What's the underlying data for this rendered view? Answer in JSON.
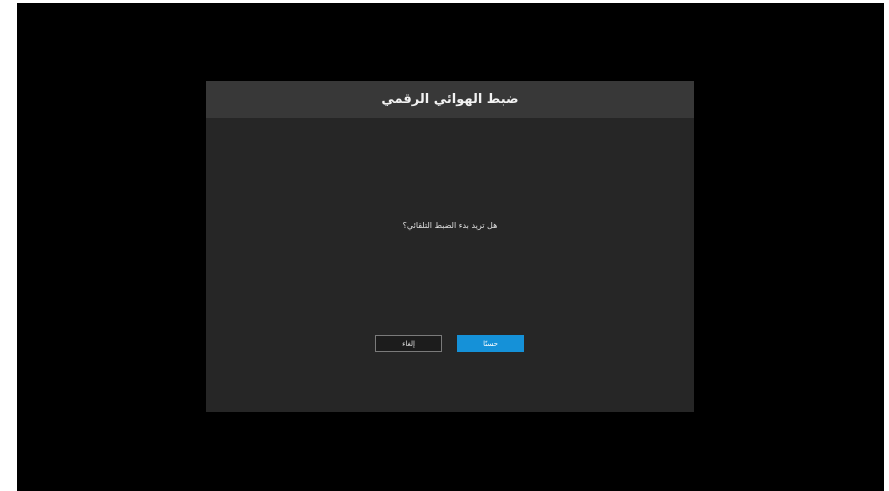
{
  "dialog": {
    "title": "ضبط الهوائي الرقمي",
    "message": "هل تريد بدء الضبط التلقائي؟",
    "ok_label": "حسنًا",
    "cancel_label": "إلغاء"
  },
  "colors": {
    "screen_background": "#000000",
    "dialog_background": "#262626",
    "header_background": "#383838",
    "ok_button": "#1591d8"
  }
}
